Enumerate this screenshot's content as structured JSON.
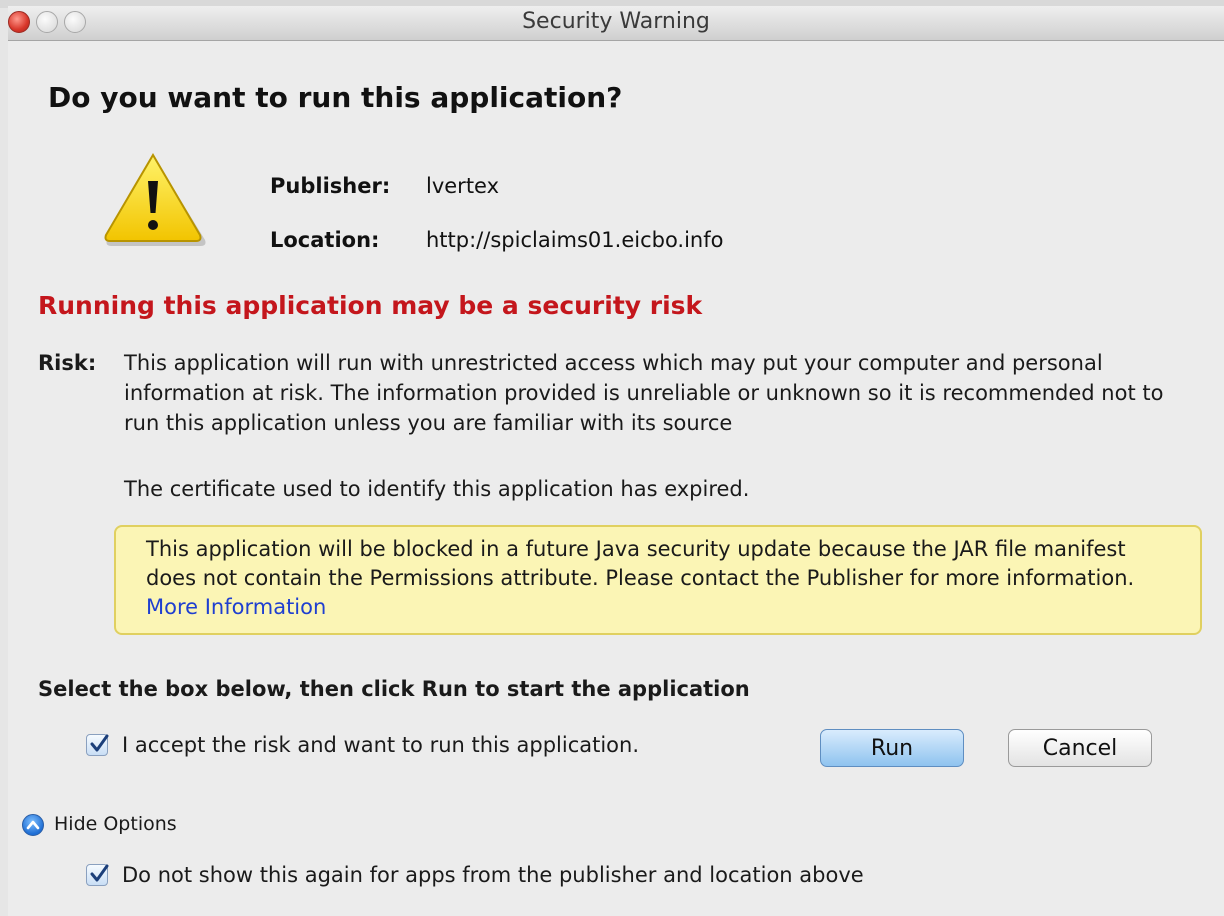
{
  "window": {
    "title": "Security Warning"
  },
  "dialog": {
    "heading": "Do you want to run this application?",
    "publisher_label": "Publisher:",
    "publisher_value": "lvertex",
    "location_label": "Location:",
    "location_value": "http://spiclaims01.eicbo.info",
    "risk_heading": "Running this application may be a security risk",
    "risk_label": "Risk:",
    "risk_text": "This application will run with unrestricted access which may put your computer and personal information at risk. The information provided is unreliable or unknown so it is recommended not to run this application unless you are familiar with its source",
    "cert_text": "The certificate used to identify this application has expired.",
    "notice_text": "This application will be blocked in a future Java security update because the JAR file manifest does not contain the Permissions attribute. Please contact the Publisher for more information.",
    "notice_link": "More Information",
    "instruction": "Select the box below, then click Run to start the application",
    "accept_label": "I accept the risk and want to run this application.",
    "accept_checked": true,
    "run_label": "Run",
    "cancel_label": "Cancel",
    "hide_options_label": "Hide Options",
    "dont_show_label": "Do not show this again for apps from the publisher and location above",
    "dont_show_checked": true
  },
  "icons": {
    "warning": "warning-triangle-icon",
    "disclosure": "chevron-up-icon",
    "check": "checkmark-icon"
  },
  "colors": {
    "risk_heading": "#c4161c",
    "notice_background": "#fbf5b5",
    "link": "#1f3fd0",
    "run_button": "#8fc3ef"
  }
}
